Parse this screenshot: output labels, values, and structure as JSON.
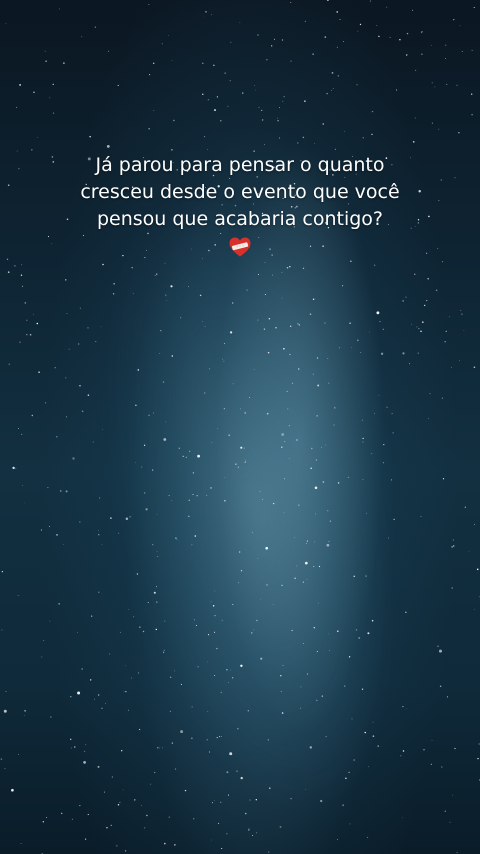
{
  "story": {
    "caption_lines": [
      "Já parou para pensar o quanto",
      "cresceu desde o evento que você",
      "pensou que acabaria contigo?"
    ],
    "emoji": "mending-heart-icon"
  },
  "colors": {
    "sky_dark": "#0b1722",
    "sky_mid": "#123041",
    "text": "#ffffff",
    "heart_red": "#d9302c"
  }
}
